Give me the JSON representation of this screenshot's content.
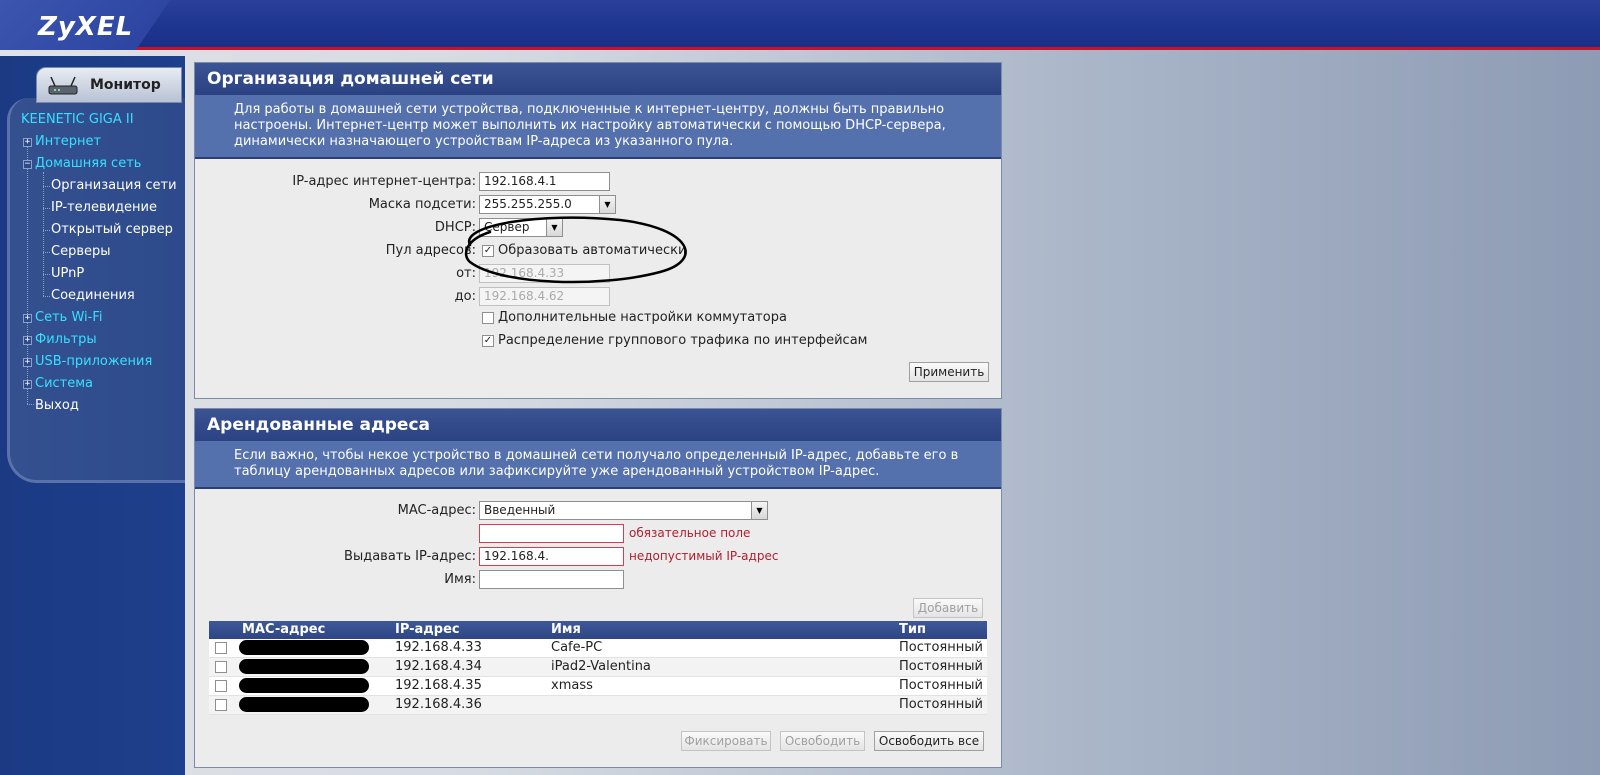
{
  "header": {
    "logo": "ZyXEL"
  },
  "sidebar": {
    "monitor_label": "Монитор",
    "device_name": "KEENETIC GIGA II",
    "items": [
      {
        "label": "Интернет"
      },
      {
        "label": "Домашняя сеть"
      },
      {
        "label": "Организация сети"
      },
      {
        "label": "IP-телевидение"
      },
      {
        "label": "Открытый сервер"
      },
      {
        "label": "Серверы"
      },
      {
        "label": "UPnP"
      },
      {
        "label": "Соединения"
      },
      {
        "label": "Сеть Wi-Fi"
      },
      {
        "label": "Фильтры"
      },
      {
        "label": "USB-приложения"
      },
      {
        "label": "Система"
      },
      {
        "label": "Выход"
      }
    ]
  },
  "network": {
    "title": "Организация домашней сети",
    "description": "Для работы в домашней сети устройства, подключенные к интернет-центру, должны быть правильно настроены. Интернет-центр может выполнить их настройку автоматически с помощью DHCP-сервера, динамически назначающего устройствам IP-адреса из указанного пула.",
    "ip_label": "IP-адрес интернет-центра:",
    "ip_value": "192.168.4.1",
    "mask_label": "Маска подсети:",
    "mask_value": "255.255.255.0",
    "dhcp_label": "DHCP:",
    "dhcp_value": "Сервер",
    "pool_label": "Пул адресов:",
    "pool_auto_label": "Образовать автоматически",
    "pool_auto_checked": true,
    "from_label": "от:",
    "from_value": "192.168.4.33",
    "to_label": "до:",
    "to_value": "192.168.4.62",
    "switch_label": "Дополнительные настройки коммутатора",
    "switch_checked": false,
    "multicast_label": "Распределение группового трафика по интерфейсам",
    "multicast_checked": true,
    "apply_label": "Применить"
  },
  "leases": {
    "title": "Арендованные адреса",
    "description": "Если важно, чтобы некое устройство в домашней сети получало определенный IP-адрес, добавьте его в таблицу арендованных адресов или зафиксируйте уже арендованный устройством IP-адрес.",
    "mac_label": "MAC-адрес:",
    "mac_select": "Введенный",
    "mac_value": "",
    "mac_error": "обязательное поле",
    "ip_label": "Выдавать IP-адрес:",
    "ip_value": "192.168.4.",
    "ip_error": "недопустимый IP-адрес",
    "name_label": "Имя:",
    "name_value": "",
    "add_label": "Добавить",
    "columns": [
      "MAC-адрес",
      "IP-адрес",
      "Имя",
      "Тип"
    ],
    "rows": [
      {
        "ip": "192.168.4.33",
        "name": "Cafe-PC",
        "type": "Постоянный"
      },
      {
        "ip": "192.168.4.34",
        "name": "iPad2-Valentina",
        "type": "Постоянный"
      },
      {
        "ip": "192.168.4.35",
        "name": "xmass",
        "type": "Постоянный"
      },
      {
        "ip": "192.168.4.36",
        "name": "",
        "type": "Постоянный"
      }
    ],
    "fix_label": "Фиксировать",
    "release_label": "Освободить",
    "release_all_label": "Освободить все"
  }
}
